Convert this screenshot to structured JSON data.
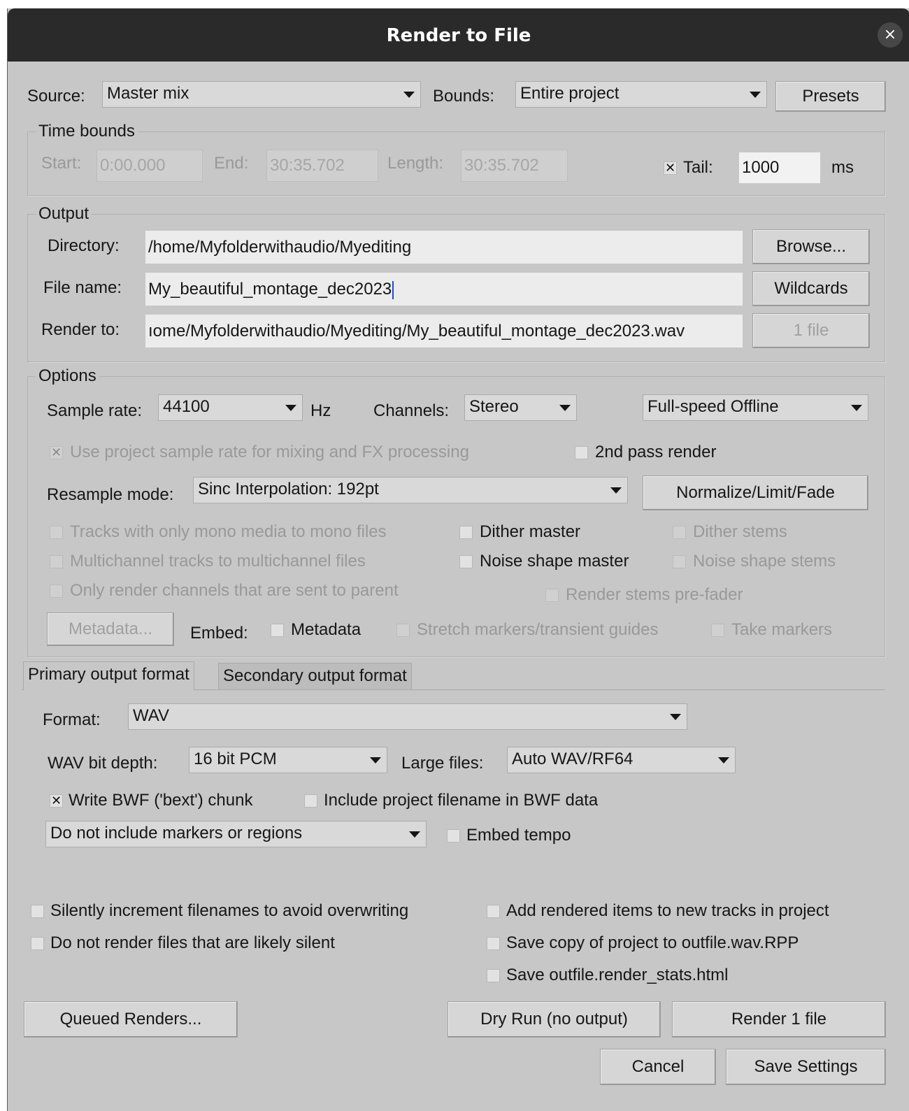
{
  "window": {
    "title": "Render to File",
    "close_glyph": "×"
  },
  "top": {
    "source_label": "Source:",
    "source_value": "Master mix",
    "bounds_label": "Bounds:",
    "bounds_value": "Entire project",
    "presets": "Presets"
  },
  "time_bounds": {
    "title": "Time bounds",
    "start_label": "Start:",
    "start_value": "0:00.000",
    "end_label": "End:",
    "end_value": "30:35.702",
    "length_label": "Length:",
    "length_value": "30:35.702",
    "tail_checked": true,
    "tail_label": "Tail:",
    "tail_value": "1000",
    "tail_unit": "ms"
  },
  "output": {
    "title": "Output",
    "directory_label": "Directory:",
    "directory_value": "/home/Myfolderwithaudio/Myediting",
    "browse": "Browse...",
    "filename_label": "File name:",
    "filename_value": "My_beautiful_montage_dec2023",
    "wildcards": "Wildcards",
    "renderto_label": "Render to:",
    "renderto_value": "ıome/Myfolderwithaudio/Myediting/My_beautiful_montage_dec2023.wav",
    "files_button": "1 file"
  },
  "options": {
    "title": "Options",
    "sample_rate_label": "Sample rate:",
    "sample_rate_value": "44100",
    "hz": "Hz",
    "channels_label": "Channels:",
    "channels_value": "Stereo",
    "speed_value": "Full-speed Offline",
    "use_project_rate": "Use project sample rate for mixing and FX processing",
    "second_pass": "2nd pass render",
    "resample_label": "Resample mode:",
    "resample_value": "Sinc Interpolation: 192pt",
    "normalize": "Normalize/Limit/Fade",
    "mono_tracks": "Tracks with only mono media to mono files",
    "dither_master": "Dither master",
    "dither_stems": "Dither stems",
    "multichannel": "Multichannel tracks to multichannel files",
    "noise_master": "Noise shape master",
    "noise_stems": "Noise shape stems",
    "only_parent": "Only render channels that are sent to parent",
    "stems_prefader": "Render stems pre-fader",
    "metadata_button": "Metadata...",
    "embed_label": "Embed:",
    "embed_metadata": "Metadata",
    "embed_stretch": "Stretch markers/transient guides",
    "embed_take": "Take markers"
  },
  "tabs": {
    "primary": "Primary output format",
    "secondary": "Secondary output format"
  },
  "format": {
    "format_label": "Format:",
    "format_value": "WAV",
    "bitdepth_label": "WAV bit depth:",
    "bitdepth_value": "16 bit PCM",
    "large_label": "Large files:",
    "large_value": "Auto WAV/RF64",
    "bwf": "Write BWF ('bext') chunk",
    "include_filename": "Include project filename in BWF data",
    "markers_value": "Do not include markers or regions",
    "embed_tempo": "Embed tempo"
  },
  "bottom": {
    "silently_increment": "Silently increment filenames to avoid overwriting",
    "no_silent": "Do not render files that are likely silent",
    "add_items": "Add rendered items to new tracks in project",
    "save_copy": "Save copy of project to outfile.wav.RPP",
    "save_stats": "Save outfile.render_stats.html",
    "queued": "Queued Renders...",
    "dry_run": "Dry Run (no output)",
    "render": "Render 1 file",
    "cancel": "Cancel",
    "save_settings": "Save Settings"
  },
  "checkmark": "✕"
}
